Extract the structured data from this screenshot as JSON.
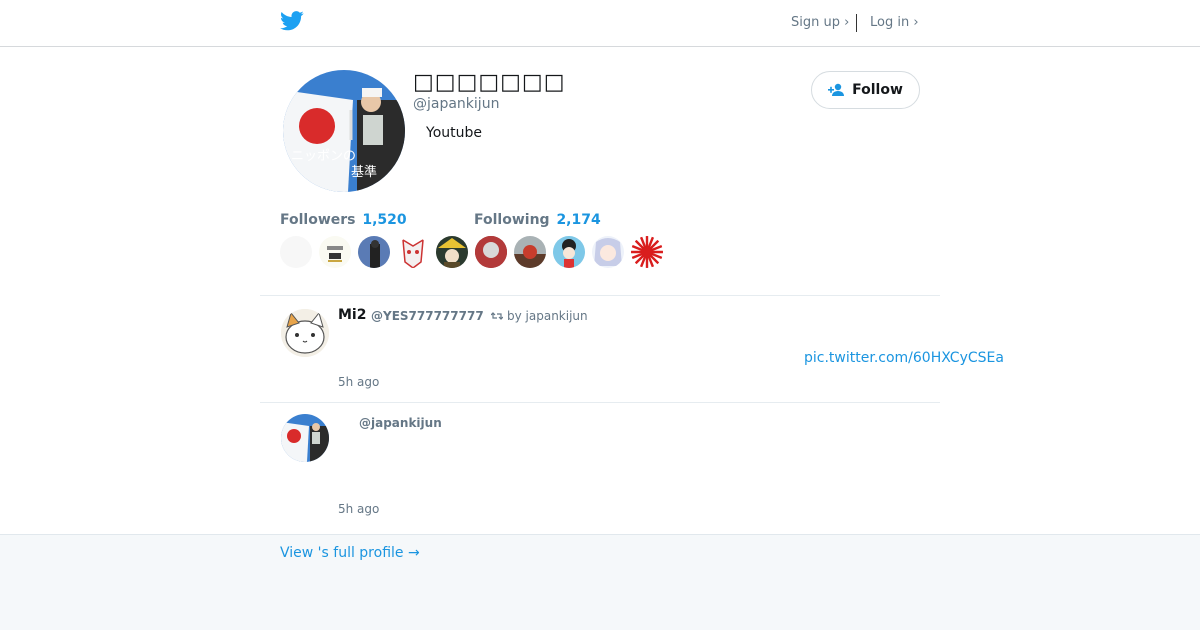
{
  "header": {
    "signup_label": "Sign up ›",
    "login_label": "Log in ›"
  },
  "profile": {
    "name": "□□□□□□□",
    "handle": "@japankijun",
    "bio": "Youtube",
    "follow_label": "Follow",
    "followers_label": "Followers",
    "followers_count": "1,520",
    "following_label": "Following",
    "following_count": "2,174",
    "avatar_caption_1": "ニッポンの",
    "avatar_caption_2": "基準"
  },
  "tweets": [
    {
      "name": "Mi2",
      "handle": "@YES777777777",
      "retweet_label": "by japankijun",
      "link": "pic.twitter.com/60HXCyCSEa",
      "time": "5h ago"
    },
    {
      "name": "",
      "handle": "@japankijun",
      "time": "5h ago"
    }
  ],
  "footer": {
    "full_profile_label": "View 's full profile →"
  },
  "colors": {
    "accent": "#1b95e0",
    "muted": "#657786"
  }
}
